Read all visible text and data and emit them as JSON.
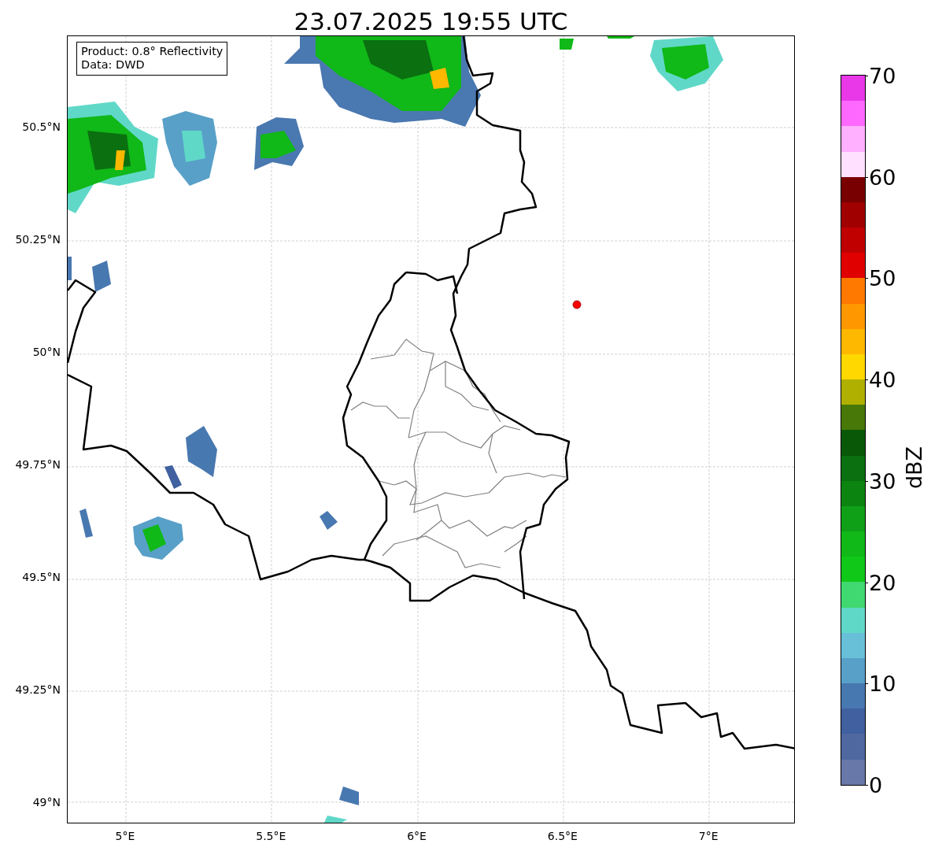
{
  "title": "23.07.2025 19:55 UTC",
  "info_box": [
    "Product: 0.8° Reflectivity",
    "Data: DWD"
  ],
  "y_ticks": [
    "50.5°N",
    "50.25°N",
    "50°N",
    "49.75°N",
    "49.5°N",
    "49.25°N",
    "49°N"
  ],
  "x_ticks": [
    "5°E",
    "5.5°E",
    "6°E",
    "6.5°E",
    "7°E"
  ],
  "colorbar": {
    "label": "dBZ",
    "ticks": [
      "70",
      "60",
      "50",
      "40",
      "30",
      "20",
      "10",
      "0"
    ],
    "bins": [
      {
        "color": "#e838e8"
      },
      {
        "color": "#ff68ff"
      },
      {
        "color": "#ffb0ff"
      },
      {
        "color": "#ffe0ff"
      },
      {
        "color": "#780000"
      },
      {
        "color": "#a00000"
      },
      {
        "color": "#c00000"
      },
      {
        "color": "#e00000"
      },
      {
        "color": "#ff7800"
      },
      {
        "color": "#ff9800"
      },
      {
        "color": "#ffb800"
      },
      {
        "color": "#ffd800"
      },
      {
        "color": "#b0b000"
      },
      {
        "color": "#487808"
      },
      {
        "color": "#085808"
      },
      {
        "color": "#0a7010"
      },
      {
        "color": "#0c8410"
      },
      {
        "color": "#0fa018"
      },
      {
        "color": "#10b818"
      },
      {
        "color": "#10c818"
      },
      {
        "color": "#40d870"
      },
      {
        "color": "#60d8c8"
      },
      {
        "color": "#68c0d8"
      },
      {
        "color": "#58a0c8"
      },
      {
        "color": "#4878b0"
      },
      {
        "color": "#4060a0"
      },
      {
        "color": "#5068a0"
      },
      {
        "color": "#6878a8"
      }
    ]
  }
}
